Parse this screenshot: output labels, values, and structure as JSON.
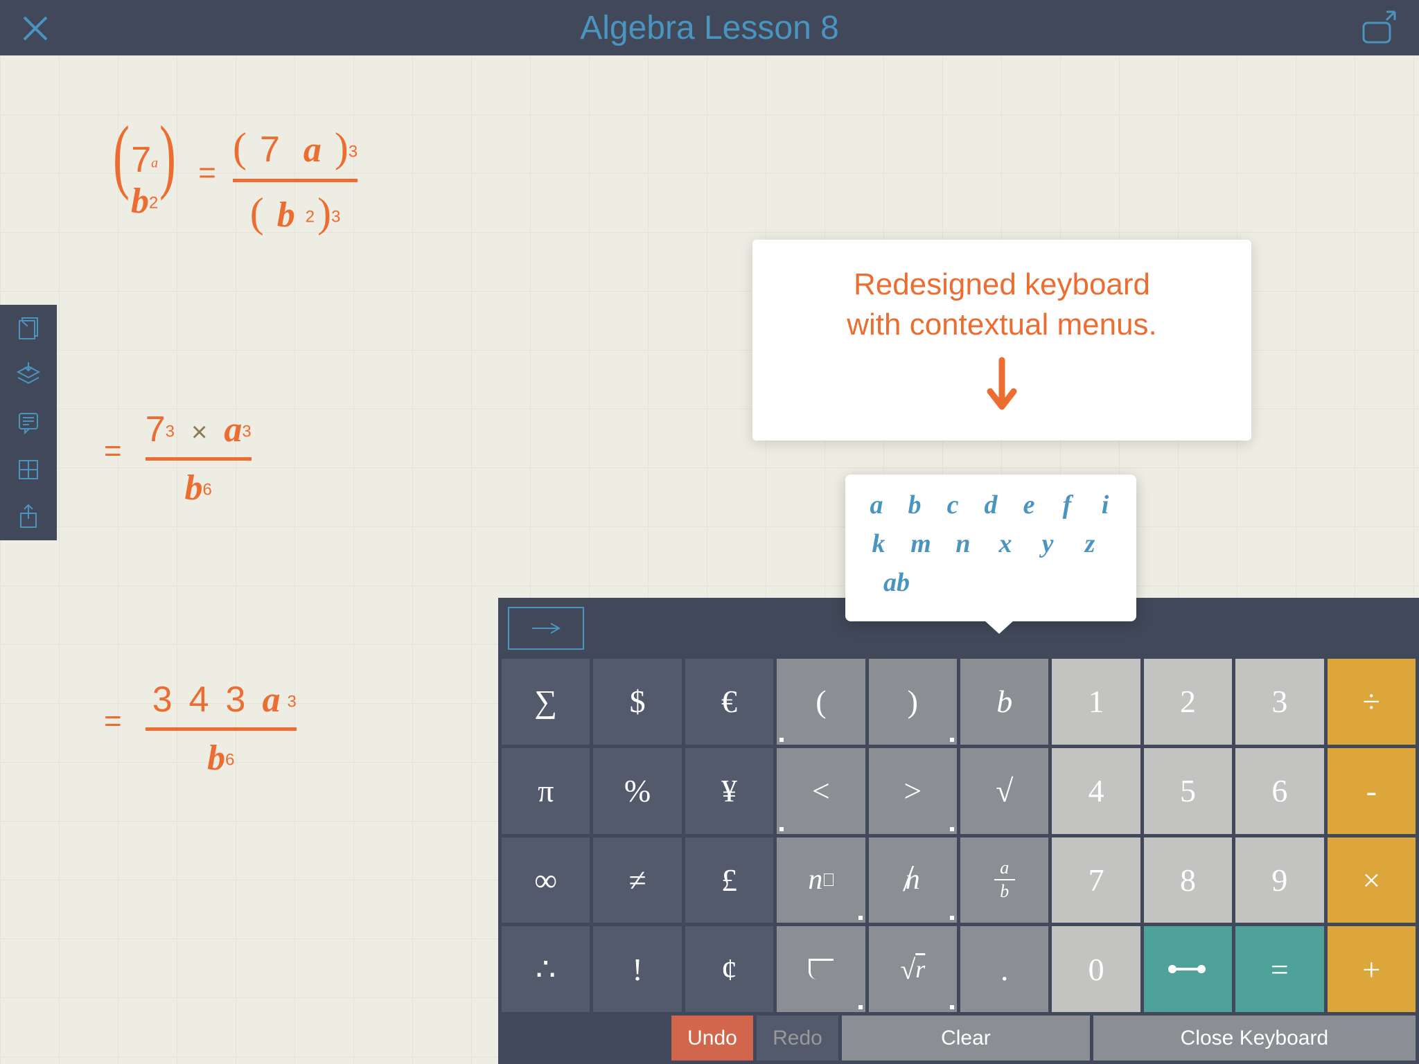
{
  "header": {
    "title": "Algebra Lesson 8"
  },
  "equation1": {
    "left_num": "7",
    "left_num_sub": "a",
    "left_den": "b",
    "left_den_sup": "2",
    "right_num_n": "7",
    "right_num_v": "a",
    "right_num_sup": "3",
    "right_den_v": "b",
    "right_den_sup": "2",
    "right_den_outer_sup": "3",
    "eq": "="
  },
  "equation2": {
    "eq": "=",
    "num_a": "7",
    "num_a_sup": "3",
    "op": "×",
    "num_b": "a",
    "num_b_sup": "3",
    "den": "b",
    "den_sup": "6"
  },
  "equation3": {
    "eq": "=",
    "d1": "3",
    "d2": "4",
    "d3": "3",
    "v": "a",
    "v_sup": "3",
    "den": "b",
    "den_sup": "6"
  },
  "callout": {
    "line1": "Redesigned keyboard",
    "line2": "with contextual menus."
  },
  "popup": {
    "row1": [
      "a",
      "b",
      "c",
      "d",
      "e",
      "f",
      "i"
    ],
    "row2": [
      "k",
      "m",
      "n",
      "x",
      "y",
      "z"
    ],
    "row3": [
      "ab"
    ]
  },
  "keyboard": {
    "grid": [
      [
        "∑",
        "$",
        "€",
        "(",
        ")",
        "b",
        "1",
        "2",
        "3",
        "÷"
      ],
      [
        "π",
        "%",
        "¥",
        "<",
        ">",
        "√",
        "4",
        "5",
        "6",
        "-"
      ],
      [
        "∞",
        "≠",
        "£",
        "n□",
        "n̸",
        "a/b",
        "7",
        "8",
        "9",
        "×"
      ],
      [
        "∴",
        "!",
        "¢",
        "⌐",
        "√r",
        ".",
        "0",
        "⟶",
        "=",
        "+"
      ]
    ],
    "bottom": {
      "undo": "Undo",
      "redo": "Redo",
      "clear": "Clear",
      "close": "Close Keyboard"
    }
  }
}
